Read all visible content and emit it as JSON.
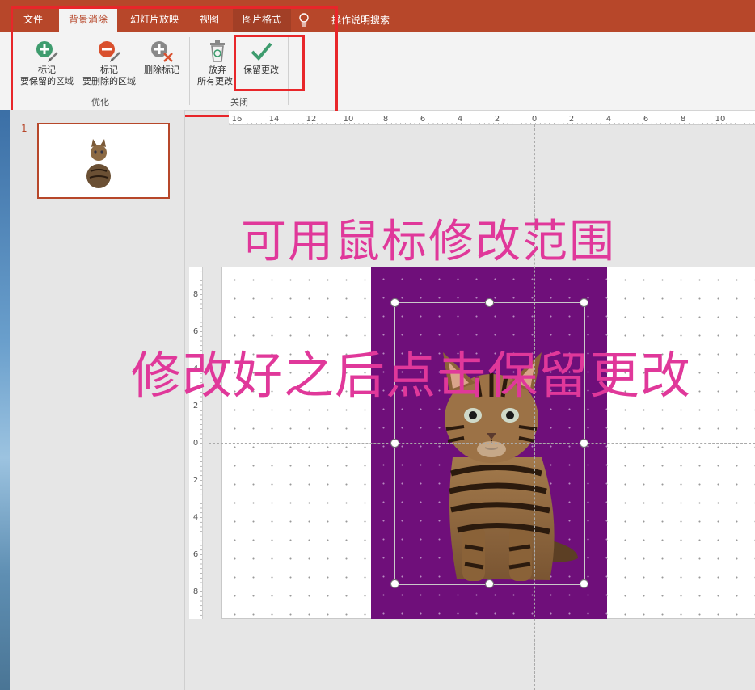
{
  "tabs": [
    {
      "label": "文件"
    },
    {
      "label": "背景消除",
      "active": true
    },
    {
      "label": "幻灯片放映"
    },
    {
      "label": "视图"
    },
    {
      "label": "图片格式",
      "context": true
    }
  ],
  "tell_me": {
    "label": "操作说明搜索"
  },
  "ribbon": {
    "mark_keep": {
      "line1": "标记",
      "line2": "要保留的区域"
    },
    "mark_remove": {
      "line1": "标记",
      "line2": "要删除的区域"
    },
    "delete_mark": {
      "label": "删除标记"
    },
    "discard_all": {
      "line1": "放弃",
      "line2": "所有更改"
    },
    "keep_changes": {
      "label": "保留更改"
    },
    "group_refine": "优化",
    "group_close": "关闭"
  },
  "slides_pane": {
    "slide_number": "1"
  },
  "ruler": {
    "h_labels": [
      "16",
      "14",
      "12",
      "10",
      "8",
      "6",
      "4",
      "2",
      "0",
      "2",
      "4",
      "6",
      "8",
      "10"
    ],
    "v_labels": [
      "8",
      "6",
      "4",
      "2",
      "0",
      "2",
      "4",
      "6",
      "8"
    ]
  },
  "annotations": {
    "line1": "可用鼠标修改范围",
    "line2": "修改好之后点击保留更改"
  },
  "colors": {
    "accent": "#b7472a",
    "remove_area": "#6f0f7a",
    "highlight_box": "#e8262a",
    "annotation": "#e0389a"
  }
}
